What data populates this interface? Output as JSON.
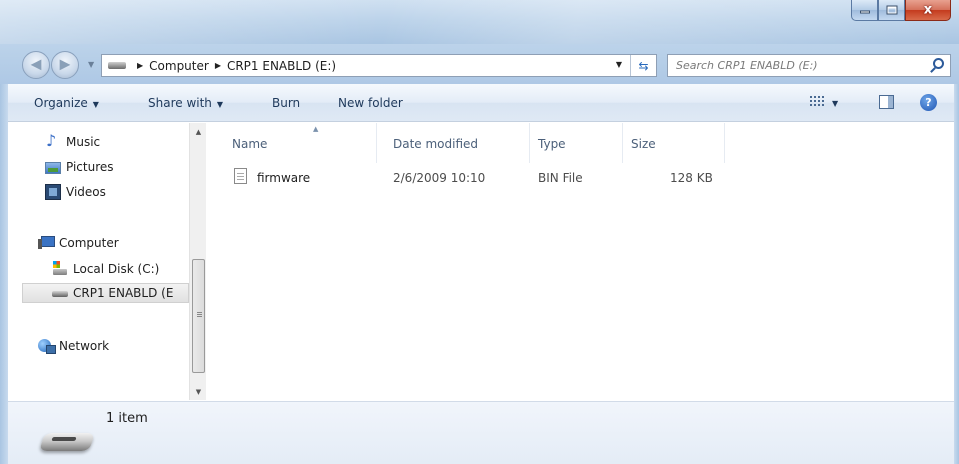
{
  "window": {
    "minimize_label": "minimize",
    "maximize_label": "maximize",
    "close_glyph": "x"
  },
  "address_bar": {
    "crumbs": [
      "Computer",
      "CRP1 ENABLD (E:)"
    ]
  },
  "search": {
    "placeholder": "Search CRP1 ENABLD (E:)"
  },
  "toolbar": {
    "organize": "Organize",
    "share_with": "Share with",
    "burn": "Burn",
    "new_folder": "New folder"
  },
  "nav_pane": {
    "music": "Music",
    "pictures": "Pictures",
    "videos": "Videos",
    "computer": "Computer",
    "local_disk": "Local Disk (C:)",
    "drive": "CRP1 ENABLD (E",
    "network": "Network"
  },
  "columns": {
    "name": "Name",
    "date_modified": "Date modified",
    "type": "Type",
    "size": "Size"
  },
  "files": [
    {
      "name": "firmware",
      "date_modified": "2/6/2009 10:10",
      "type": "BIN File",
      "size": "128 KB"
    }
  ],
  "details_pane": {
    "item_count": "1 item"
  },
  "icons": {
    "back": "back-arrow-icon",
    "forward": "forward-arrow-icon",
    "refresh": "refresh-icon",
    "search": "search-icon",
    "help": "help-icon"
  }
}
